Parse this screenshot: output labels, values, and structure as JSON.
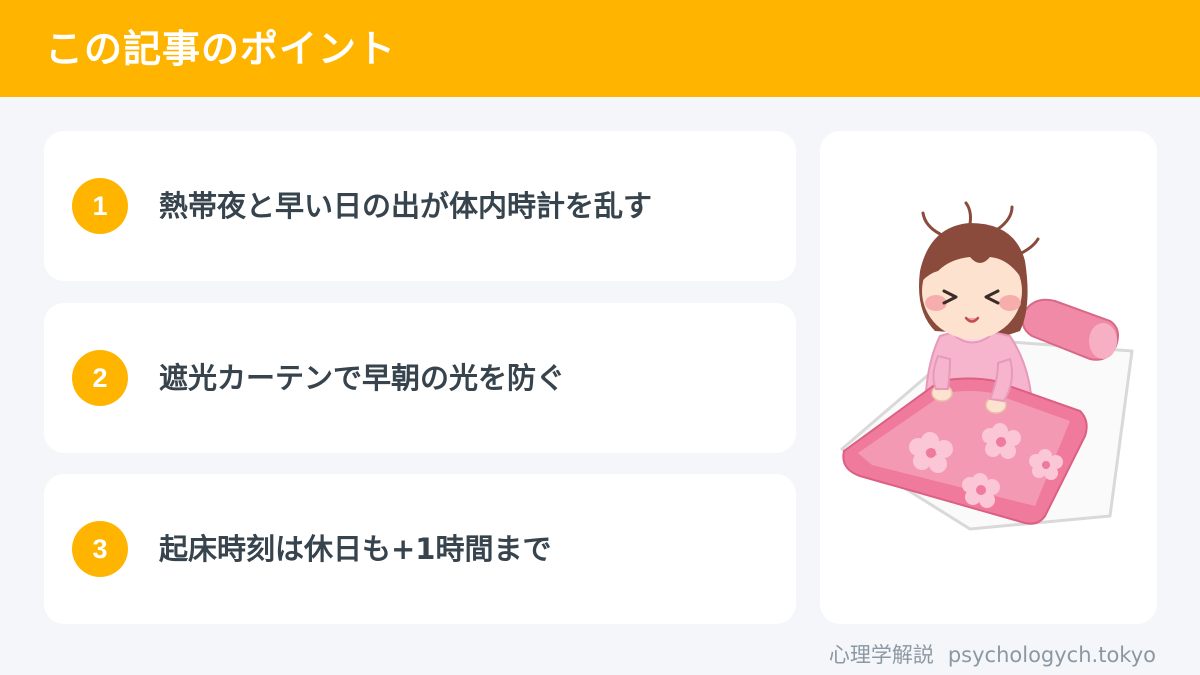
{
  "header": {
    "title": "この記事のポイント"
  },
  "points": [
    {
      "number": "1",
      "text": "熱帯夜と早い日の出が体内時計を乱す"
    },
    {
      "number": "2",
      "text": "遮光カーテンで早朝の光を防ぐ"
    },
    {
      "number": "3",
      "text": "起床時刻は休日も+1時間まで"
    }
  ],
  "illustration": {
    "icon": "girl-waking-in-bed-illustration"
  },
  "footer": {
    "brand": "心理学解説",
    "site": "psychologych.tokyo"
  },
  "colors": {
    "accent": "#ffb400",
    "background": "#f5f6f9",
    "card": "#ffffff",
    "text": "#37444d",
    "footer_text": "#8b98a4",
    "futon_pink": "#ee7b9a"
  }
}
